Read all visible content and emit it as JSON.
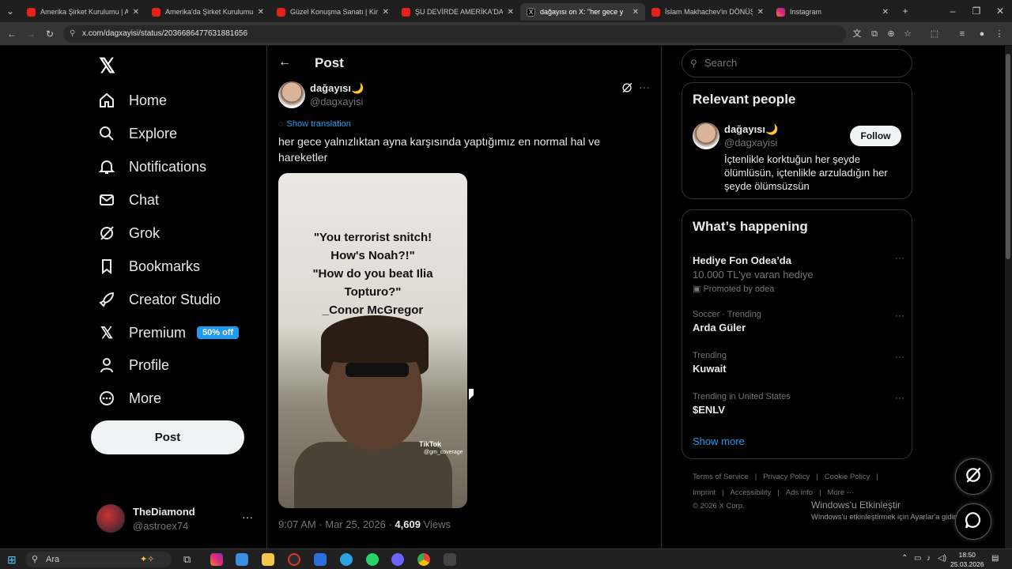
{
  "browser": {
    "tabs": [
      {
        "title": "Amerika Şirket Kurulumu | A'da",
        "favicon_color": "#e62117"
      },
      {
        "title": "Amerika'da Şirket Kurulumu (U",
        "favicon_color": "#e62117"
      },
      {
        "title": "Güzel Konuşma Sanatı | Kimse",
        "favicon_color": "#e62117"
      },
      {
        "title": "ŞU DEVİRDE AMERİKA'DA YAŞ",
        "favicon_color": "#e62117"
      },
      {
        "title": "dağayısı on X: \"her gece y",
        "favicon_color": "#000000"
      },
      {
        "title": "İslam Makhachev'in DÖNÜŞ TA",
        "favicon_color": "#e62117"
      },
      {
        "title": "Instagram",
        "favicon_color": "#d62976"
      }
    ],
    "url": "x.com/dagxayisi/status/2036686477631881656"
  },
  "nav": {
    "items": [
      {
        "label": "Home",
        "icon": "home-icon"
      },
      {
        "label": "Explore",
        "icon": "search-icon"
      },
      {
        "label": "Notifications",
        "icon": "bell-icon"
      },
      {
        "label": "Chat",
        "icon": "mail-icon"
      },
      {
        "label": "Grok",
        "icon": "grok-icon"
      },
      {
        "label": "Bookmarks",
        "icon": "bookmark-icon"
      },
      {
        "label": "Creator Studio",
        "icon": "rocket-icon"
      },
      {
        "label": "Premium",
        "icon": "x-logo-icon"
      },
      {
        "label": "Profile",
        "icon": "person-icon"
      },
      {
        "label": "More",
        "icon": "more-circle-icon"
      }
    ],
    "premium_badge": "50% off",
    "post_button": "Post",
    "account": {
      "name": "TheDiamond",
      "handle": "@astroex74"
    }
  },
  "post": {
    "header": "Post",
    "author_name": "dağayısı🌙",
    "author_handle": "@dagxayisi",
    "show_translation": "Show translation",
    "text": "her gece yalnızlıktan ayna karşısında yaptığımız en normal hal ve hareketler",
    "media_caption": "\"You terrorist snitch!\nHow's Noah?!\"\n\"How do you beat Ilia\nTopturo?\"\n_Conor McGregor",
    "media_watermark": "TikTok",
    "media_watermark_handle": "@gm_coverage",
    "time": "9:07 AM · Mar 25, 2026 · ",
    "views_count": "4,609",
    "views_label": " Views"
  },
  "sidebar": {
    "search_placeholder": "Search",
    "relevant": {
      "title": "Relevant people",
      "name": "dağayısı🌙",
      "handle": "@dagxayisi",
      "bio": "İçtenlikle korktuğun her şeyde ölümlüsün, içtenlikle arzuladığın her şeyde ölümsüzsün",
      "follow": "Follow"
    },
    "happening": {
      "title": "What’s happening",
      "trends": [
        {
          "context": "",
          "title": "Hediye Fon Odea’da",
          "subtitle": "10.000 TL'ye varan hediye",
          "promo": "Promoted by odea"
        },
        {
          "context": "Soccer · Trending",
          "title": "Arda Güler",
          "subtitle": "",
          "promo": ""
        },
        {
          "context": "Trending",
          "title": "Kuwait",
          "subtitle": "",
          "promo": ""
        },
        {
          "context": "Trending in United States",
          "title": "$ENLV",
          "subtitle": "",
          "promo": ""
        }
      ],
      "show_more": "Show more"
    },
    "footer": {
      "links1": [
        "Terms of Service",
        "|",
        "Privacy Policy",
        "|",
        "Cookie Policy",
        "|"
      ],
      "links2": [
        "Imprint",
        "|",
        "Accessibility",
        "|",
        "Ads info",
        "|",
        "More ···"
      ],
      "copyright": "© 2026 X Corp."
    }
  },
  "windows": {
    "activate_title": "Windows'u Etkinleştir",
    "activate_sub": "Windows'u etkinleştirmek için Ayarlar'a gidin.",
    "search": "Ara",
    "time": "18:50",
    "date": "25.03.2026"
  }
}
